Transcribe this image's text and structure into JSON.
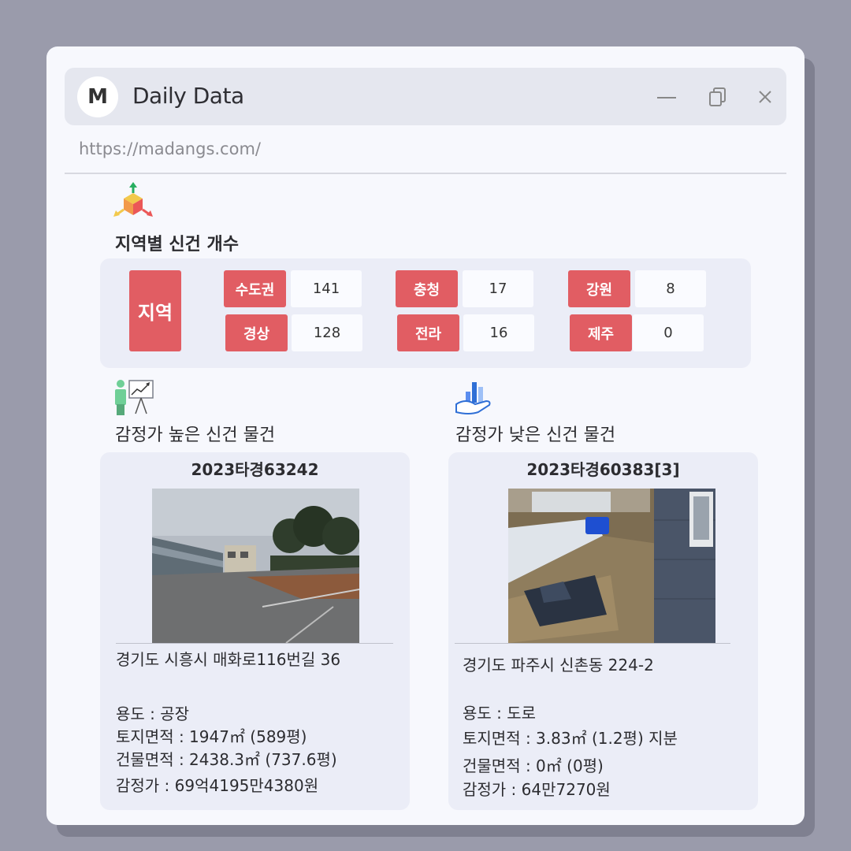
{
  "window": {
    "avatar_letter": "M",
    "title": "Daily Data",
    "url": "https://madangs.com/"
  },
  "regions": {
    "title": "지역별 신건 개수",
    "label": "지역",
    "items": [
      {
        "name": "수도권",
        "count": "141"
      },
      {
        "name": "충청",
        "count": "17"
      },
      {
        "name": "강원",
        "count": "8"
      },
      {
        "name": "경상",
        "count": "128"
      },
      {
        "name": "전라",
        "count": "16"
      },
      {
        "name": "제주",
        "count": "0"
      }
    ]
  },
  "high": {
    "title": "감정가 높은 신건 물건",
    "case_no": "2023타경63242",
    "address": "경기도 시흥시 매화로116번길 36",
    "usage": "용도 : 공장",
    "land_area": "토지면적 : 1947㎡ (589평)",
    "building_area": "건물면적 : 2438.3㎡ (737.6평)",
    "appraisal": "감정가 : 69억4195만4380원"
  },
  "low": {
    "title": "감정가 낮은 신건 물건",
    "case_no": "2023타경60383[3]",
    "address": "경기도 파주시 신촌동 224-2",
    "usage": "용도 :  도로",
    "land_area": "토지면적 : 3.83㎡ (1.2평) 지분",
    "building_area": "건물면적 : 0㎡ (0평)",
    "appraisal": "감정가 : 64만7270원"
  },
  "colors": {
    "accent": "#e15d63",
    "panel": "#ebedf7",
    "background": "#9a9bab"
  }
}
